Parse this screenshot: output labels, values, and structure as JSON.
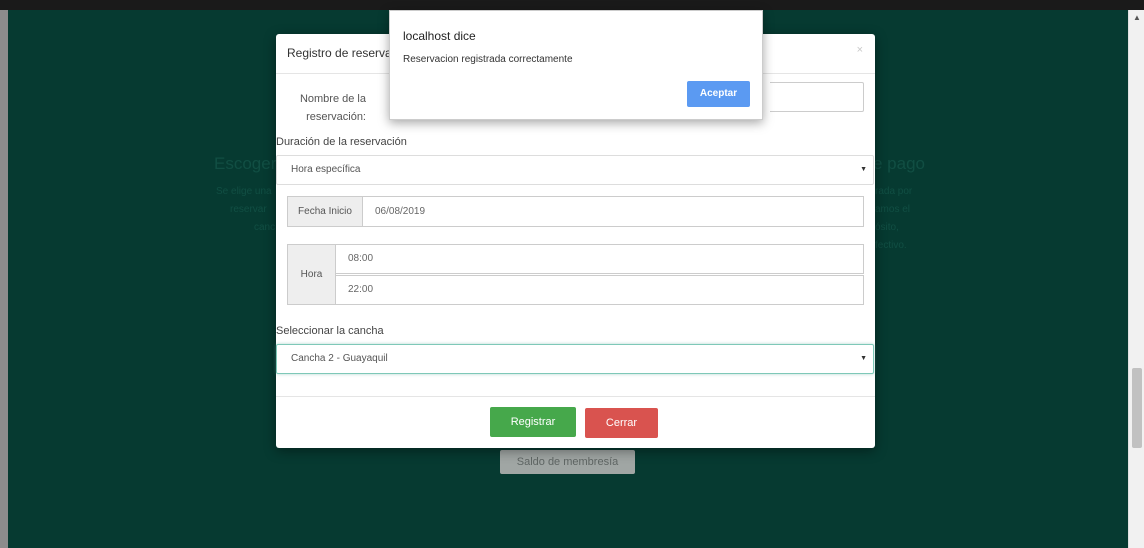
{
  "background": {
    "left_heading": "Escoger",
    "left_text": [
      "Se elige una",
      "reservar",
      "canc"
    ],
    "right_heading": "e pago",
    "right_text": [
      "rada por",
      "amos el",
      "ósito,",
      "fectivo."
    ],
    "membership_button": "Saldo de membresía"
  },
  "modal": {
    "title": "Registro de reserva",
    "close_icon": "×",
    "name_label": "Nombre de la reservación:",
    "name_value": "",
    "duration_label": "Duración de la reservación",
    "duration_selected": "Hora específica",
    "start_date_label": "Fecha Inicio",
    "start_date_value": "06/08/2019",
    "time_label": "Hora",
    "time_start": "08:00",
    "time_end": "22:00",
    "court_label": "Seleccionar la cancha",
    "court_selected": "Cancha 2 - Guayaquil",
    "register_button": "Registrar",
    "close_button": "Cerrar"
  },
  "alert": {
    "title": "localhost dice",
    "message": "Reservacion registrada correctamente",
    "accept_button": "Aceptar"
  },
  "colors": {
    "page_bg": "#0b6a5a",
    "register_green": "#46a84b",
    "close_red": "#d9534f",
    "accept_blue": "#5b9af2"
  }
}
